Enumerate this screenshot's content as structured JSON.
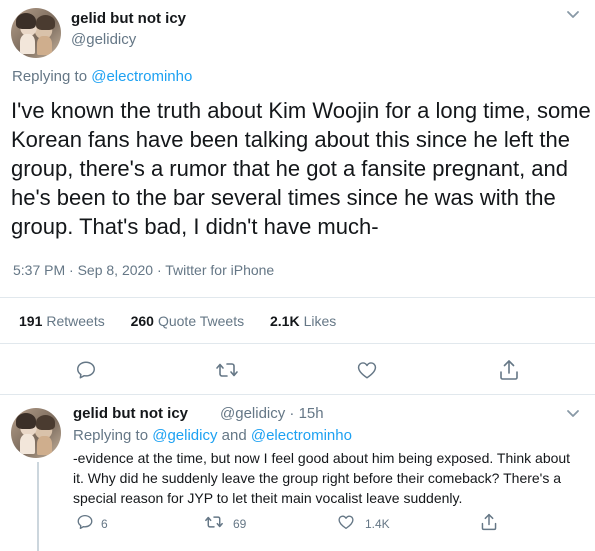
{
  "tweet": {
    "display_name": "gelid but not icy",
    "handle": "@gelidicy",
    "replying_prefix": "Replying to ",
    "replying_to": "@electrominho",
    "text": "I've known the truth about Kim Woojin for a long time, some Korean fans have been talking about this since he left the group, there's a rumor that he got a fansite pregnant, and he's been to the bar several times since he was with the group. That's bad, I didn't have much-",
    "timestamp": "5:37 PM · Sep 8, 2020 · Twitter for iPhone",
    "stats": {
      "retweets_count": "191",
      "retweets_label": "Retweets",
      "quotes_count": "260",
      "quotes_label": "Quote Tweets",
      "likes_count": "2.1K",
      "likes_label": "Likes"
    },
    "actions": [
      "reply-icon",
      "retweet-icon",
      "like-icon",
      "share-icon"
    ]
  },
  "reply": {
    "display_name": "gelid but not icy",
    "handle_time": "@gelidicy · 15h",
    "replying_prefix": "Replying to ",
    "replying_to_1": "@gelidicy",
    "replying_and": " and ",
    "replying_to_2": "@electrominho",
    "text": "-evidence at the time, but now I feel good about him being exposed. Think about it. Why did he suddenly leave the group right before their comeback? There's a special reason for JYP to let theit main vocalist leave suddenly.",
    "reply_count": "6",
    "retweet_count": "69",
    "like_count": "1.4K"
  },
  "colors": {
    "link": "#1da1f2",
    "secondary": "#657786",
    "divider": "#e1e8ed",
    "icon": "#657786"
  }
}
